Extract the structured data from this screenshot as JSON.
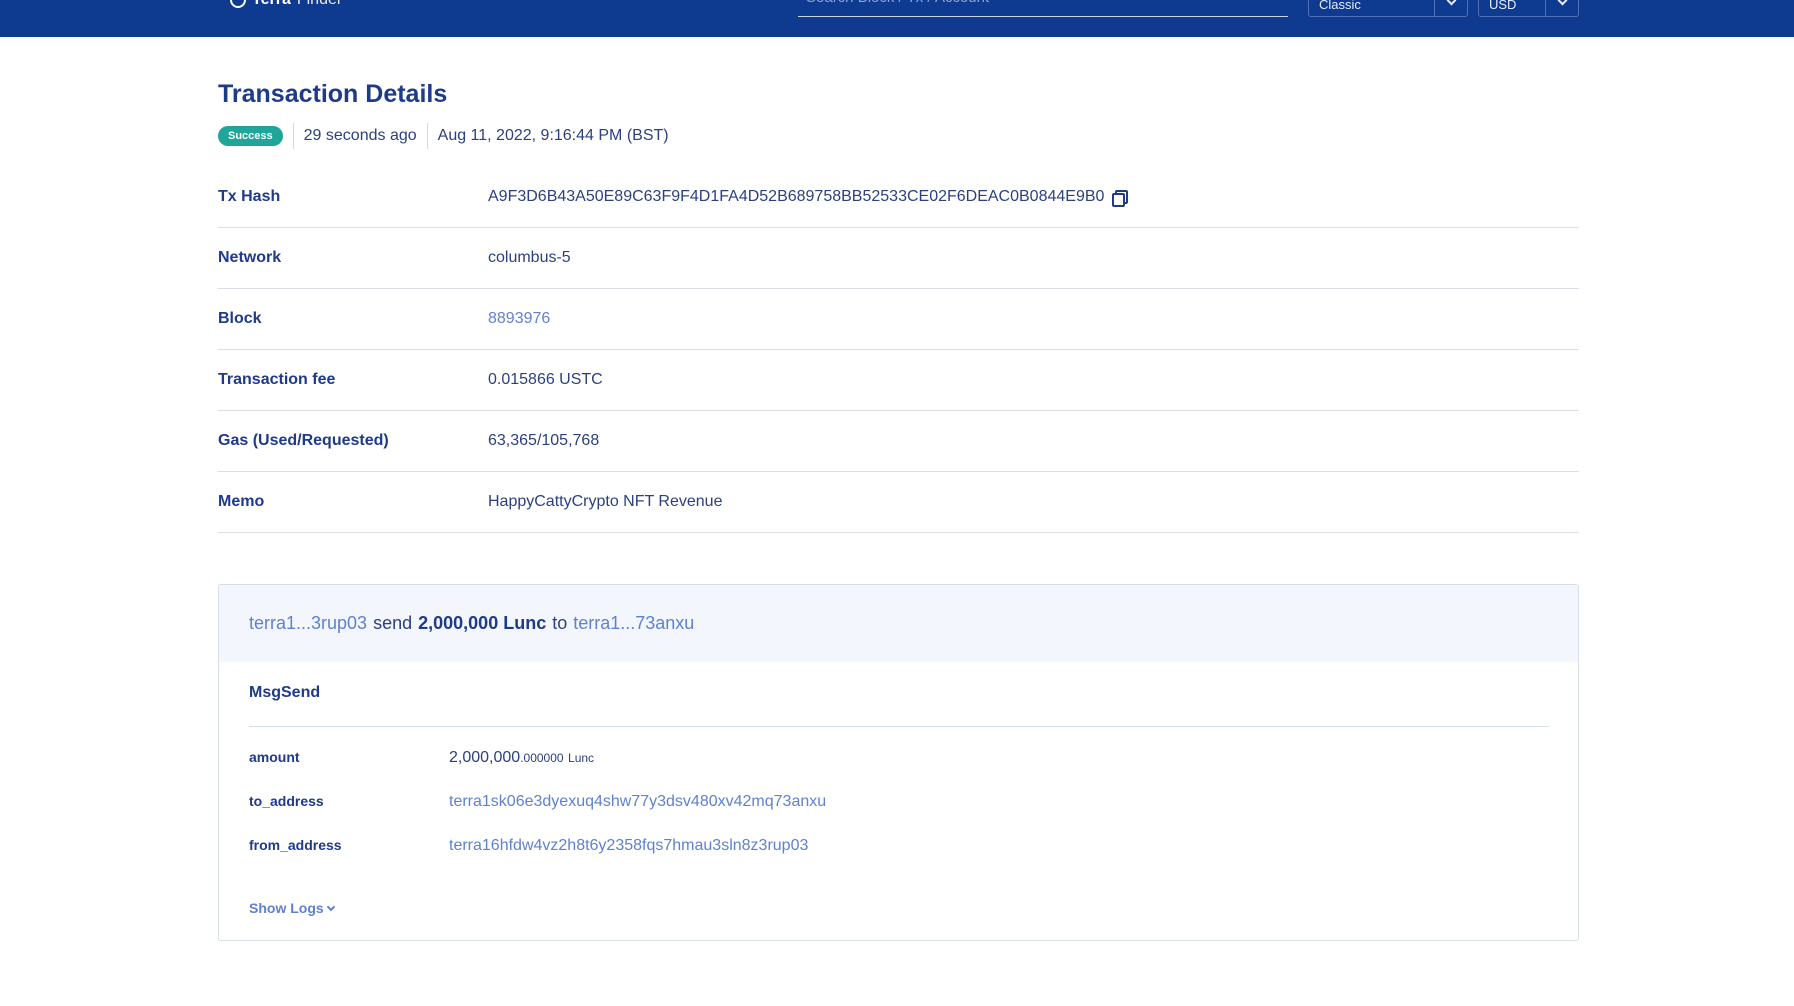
{
  "header": {
    "brand_primary": "Terra",
    "brand_secondary": "Finder",
    "search_placeholder": "Search Block / Tx / Account",
    "network_select": "Classic",
    "currency_select": "USD"
  },
  "page": {
    "title": "Transaction Details",
    "status": "Success",
    "relative_time": "29 seconds ago",
    "timestamp": "Aug 11, 2022, 9:16:44 PM (BST)"
  },
  "details": [
    {
      "label": "Tx Hash",
      "value": "A9F3D6B43A50E89C63F9F4D1FA4D52B689758BB52533CE02F6DEAC0B0844E9B0"
    },
    {
      "label": "Network",
      "value": "columbus-5"
    },
    {
      "label": "Block",
      "value": "8893976"
    },
    {
      "label": "Transaction fee",
      "value": "0.015866 USTC"
    },
    {
      "label": "Gas (Used/Requested)",
      "value": "63,365/105,768"
    },
    {
      "label": "Memo",
      "value": "HappyCattyCrypto NFT Revenue"
    }
  ],
  "message": {
    "from_short": "terra1...3rup03",
    "verb": "send",
    "amount_text": "2,000,000 Lunc",
    "to_word": "to",
    "to_short": "terra1...73anxu",
    "type": "MsgSend",
    "amount_label": "amount",
    "amount_main": "2,000,000",
    "amount_decimals": ".000000",
    "amount_denom": "Lunc",
    "to_label": "to_address",
    "to_address": "terra1sk06e3dyexuq4shw77y3dsv480xv42mq73anxu",
    "from_label": "from_address",
    "from_address": "terra16hfdw4vz2h8t6y2358fqs7hmau3sln8z3rup03",
    "show_logs": "Show Logs"
  }
}
